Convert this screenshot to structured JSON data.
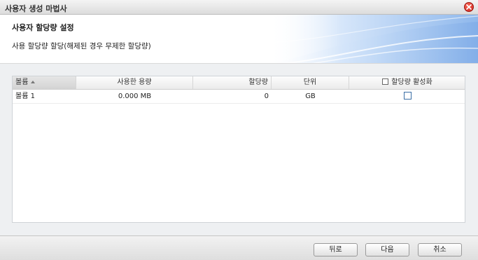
{
  "window": {
    "title": "사용자 생성 마법사"
  },
  "step": {
    "title": "사용자 할당량 설정",
    "description": "사용 할당량 할당(해제된 경우 무제한 할당량)"
  },
  "table": {
    "columns": {
      "volume": "볼륨",
      "used": "사용한 용량",
      "quota": "할당량",
      "unit": "단위",
      "enable": "할당량 활성화"
    },
    "rows": [
      {
        "volume": "볼륨 1",
        "used": "0.000 MB",
        "quota": "0",
        "unit": "GB",
        "enabled": false
      }
    ]
  },
  "buttons": {
    "back": "뒤로",
    "next": "다음",
    "cancel": "취소"
  },
  "colors": {
    "close_button": "#d9312a",
    "header_wave": "#aecdf3"
  }
}
